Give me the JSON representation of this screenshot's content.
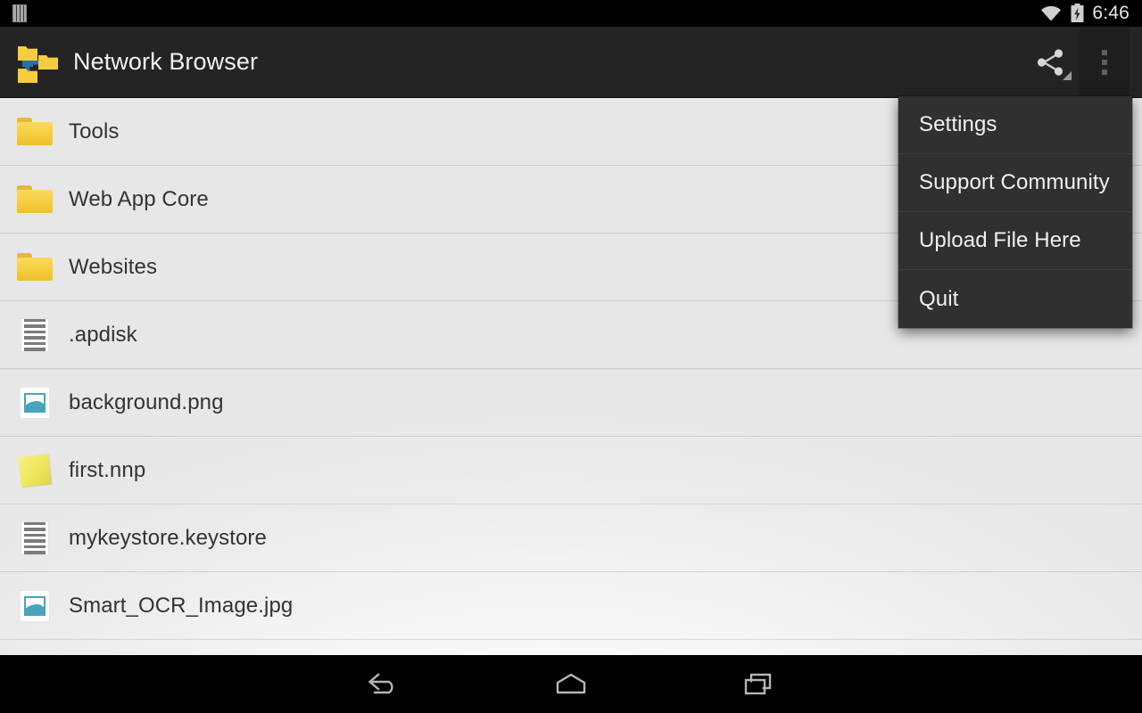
{
  "status_bar": {
    "sim_icon": "sim-card-icon",
    "wifi_icon": "wifi-icon",
    "battery_icon": "battery-charging-icon",
    "time": "6:46"
  },
  "action_bar": {
    "logo_icon": "network-folders-logo-icon",
    "title": "Network Browser",
    "share_icon": "share-icon",
    "overflow_icon": "overflow-menu-icon"
  },
  "overflow_menu": {
    "items": [
      {
        "label": "Settings"
      },
      {
        "label": "Support Community"
      },
      {
        "label": "Upload File Here"
      },
      {
        "label": "Quit"
      }
    ]
  },
  "file_list": {
    "rows": [
      {
        "name": "Tools",
        "icon": "folder-icon"
      },
      {
        "name": "Web App Core",
        "icon": "folder-icon"
      },
      {
        "name": "Websites",
        "icon": "folder-icon"
      },
      {
        "name": ".apdisk",
        "icon": "text-file-icon"
      },
      {
        "name": "background.png",
        "icon": "image-file-icon"
      },
      {
        "name": "first.nnp",
        "icon": "note-file-icon"
      },
      {
        "name": "mykeystore.keystore",
        "icon": "text-file-icon"
      },
      {
        "name": "Smart_OCR_Image.jpg",
        "icon": "image-file-icon"
      },
      {
        "name": "",
        "icon": "image-file-icon"
      }
    ]
  },
  "nav_bar": {
    "back_icon": "back-arrow-icon",
    "home_icon": "home-icon",
    "recents_icon": "recent-apps-icon"
  },
  "colors": {
    "action_bar_bg": "#242424",
    "status_bar_bg": "#000000",
    "menu_bg": "#303030",
    "folder_yellow": "#f5cd3f",
    "image_accent": "#4aa3bd",
    "list_text": "#333333",
    "nav_bar_bg": "#000000"
  }
}
